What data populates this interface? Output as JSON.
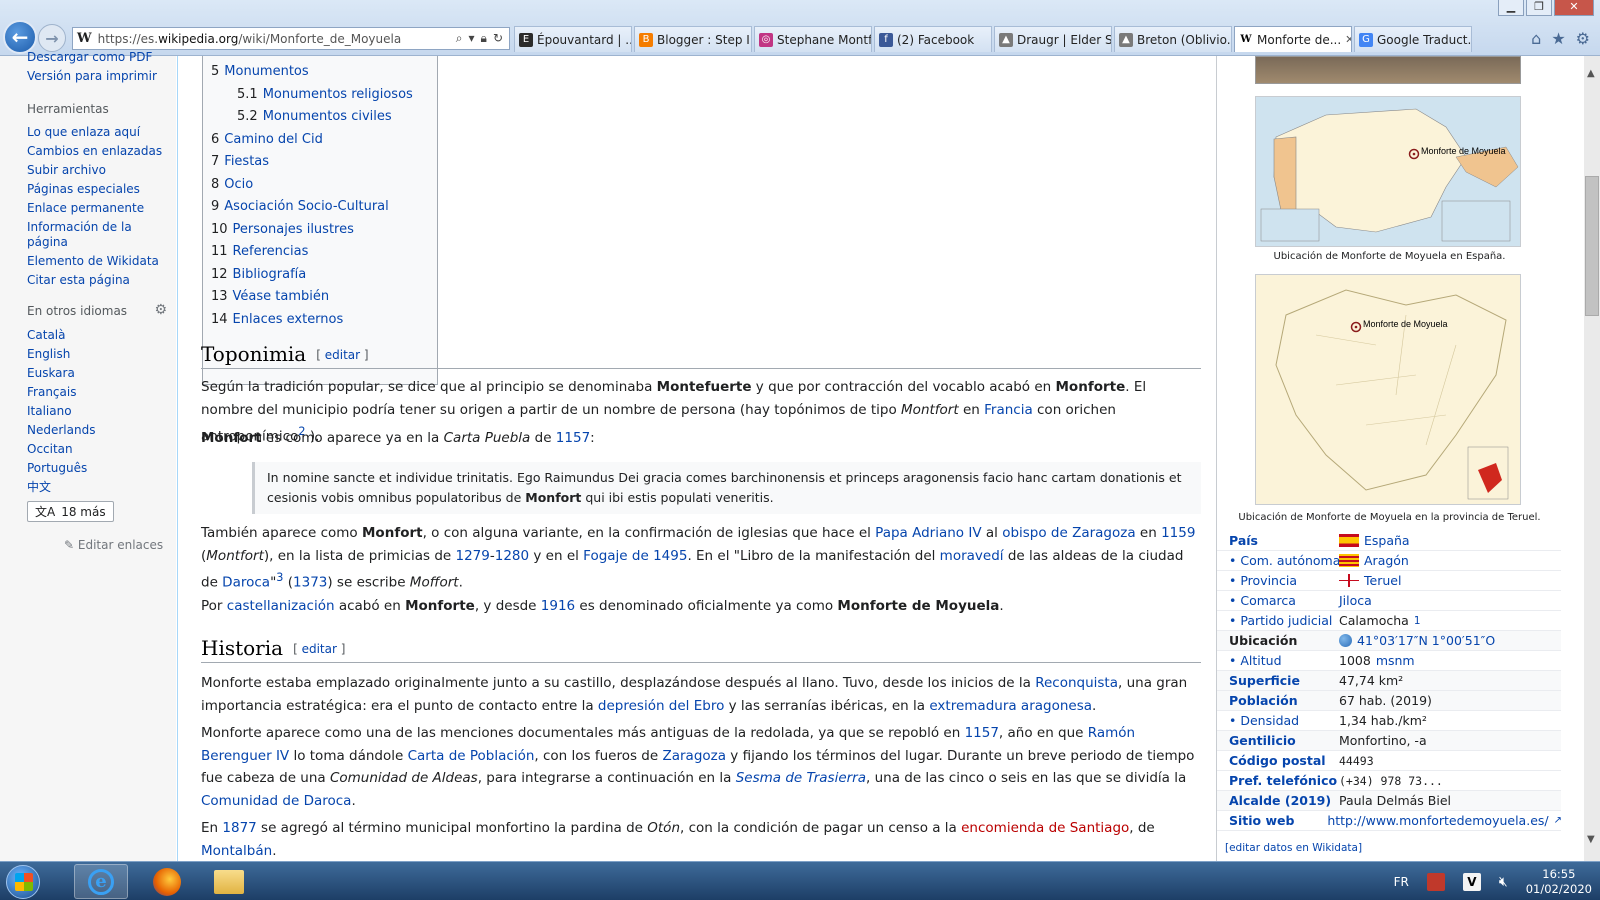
{
  "browser": {
    "url_prefix": "https://es.",
    "url_domain": "wikipedia.org",
    "url_path": "/wiki/Monforte_de_Moyuela",
    "tabs": [
      {
        "label": "Épouvantard | ...",
        "color": "#2b2b2b",
        "glyph": "E",
        "active": false
      },
      {
        "label": "Blogger : Step I...",
        "color": "#f57d00",
        "glyph": "B",
        "active": false
      },
      {
        "label": "Stephane Montf...",
        "color": "#c13584",
        "glyph": "◎",
        "active": false
      },
      {
        "label": "(2) Facebook",
        "color": "#3b5998",
        "glyph": "f",
        "active": false
      },
      {
        "label": "Draugr | Elder S...",
        "color": "#7a7a7a",
        "glyph": "▲",
        "active": false
      },
      {
        "label": "Breton (Oblivio...",
        "color": "#7a7a7a",
        "glyph": "▲",
        "active": false
      },
      {
        "label": "Monforte de...",
        "color": "#ffffff",
        "glyph": "W",
        "active": true
      },
      {
        "label": "Google Traduct...",
        "color": "#4285f4",
        "glyph": "G",
        "active": false
      }
    ]
  },
  "sidebar": {
    "top_links": [
      "Descargar como PDF",
      "Versión para imprimir"
    ],
    "tools_heading": "Herramientas",
    "tools": [
      "Lo que enlaza aquí",
      "Cambios en enlazadas",
      "Subir archivo",
      "Páginas especiales",
      "Enlace permanente",
      "Información de la página",
      "Elemento de Wikidata",
      "Citar esta página"
    ],
    "langs_heading": "En otros idiomas",
    "languages": [
      "Català",
      "English",
      "Euskara",
      "Français",
      "Italiano",
      "Nederlands",
      "Occitan",
      "Português",
      "中文"
    ],
    "more_langs": "18 más",
    "edit_links": "Editar enlaces"
  },
  "toc": [
    {
      "num": "5",
      "label": "Monumentos",
      "sub": false
    },
    {
      "num": "5.1",
      "label": "Monumentos religiosos",
      "sub": true
    },
    {
      "num": "5.2",
      "label": "Monumentos civiles",
      "sub": true
    },
    {
      "num": "6",
      "label": "Camino del Cid",
      "sub": false
    },
    {
      "num": "7",
      "label": "Fiestas",
      "sub": false
    },
    {
      "num": "8",
      "label": "Ocio",
      "sub": false
    },
    {
      "num": "9",
      "label": "Asociación Socio-Cultural",
      "sub": false
    },
    {
      "num": "10",
      "label": "Personajes ilustres",
      "sub": false
    },
    {
      "num": "11",
      "label": "Referencias",
      "sub": false
    },
    {
      "num": "12",
      "label": "Bibliografía",
      "sub": false
    },
    {
      "num": "13",
      "label": "Véase también",
      "sub": false
    },
    {
      "num": "14",
      "label": "Enlaces externos",
      "sub": false
    }
  ],
  "article": {
    "edit_label": "editar",
    "toponimia": {
      "heading": "Toponimia",
      "p1_html": "Según la tradición popular, se dice que al principio se denominaba <b>Montefuerte</b> y que por contracción del vocablo acabó en <b>Monforte</b>. El nombre del municipio podría tener su origen a partir de un nombre de persona (hay topónimos de tipo <i>Montfort</i> en <a>Francia</a> con orichen antroponímico<sup><a>2</a></sup> ).",
      "p2_html": "<b>Monfort</b> es como aparece ya en la <i>Carta Puebla</i> de <a>1157</a>:",
      "quote_html": "In nomine sancte et individue trinitatis. Ego Raimundus Dei gracia comes barchinonensis et princeps aragonensis facio hanc cartam donationis et cesionis vobis omnibus populatoribus de <b>Monfort</b> qui ibi estis populati veneritis.",
      "p3_html": "También aparece como <b>Monfort</b>, o con alguna variante, en la confirmación de iglesias que hace el <a>Papa Adriano IV</a> al <a>obispo de Zaragoza</a> en <a>1159</a> (<i>Montfort</i>), en la lista de primicias de <a>1279</a>-<a>1280</a> y en el <a>Fogaje de 1495</a>. En el \"Libro de la manifestación del <a>moravedí</a> de las aldeas de la ciudad de <a>Daroca</a>\"<sup><a>3</a></sup> (<a>1373</a>) se escribe <i>Moffort</i>.",
      "p4_html": "Por <a>castellanización</a> acabó en <b>Monforte</b>, y desde <a>1916</a> es denominado oficialmente ya como <b>Monforte de Moyuela</b>."
    },
    "historia": {
      "heading": "Historia",
      "p1_html": "Monforte estaba emplazado originalmente junto a su castillo, desplazándose después al llano. Tuvo, desde los inicios de la <a>Reconquista</a>, una gran importancia estratégica: era el punto de contacto entre la <a>depresión del Ebro</a> y las serranías ibéricas, en la <a>extremadura aragonesa</a>.",
      "p2_html": "Monforte aparece como una de las menciones documentales más antiguas de la redolada, ya que se repobló en <a>1157</a>, año en que <a>Ramón Berenguer IV</a> lo toma dándole <a>Carta de Población</a>, con los fueros de <a>Zaragoza</a> y fijando los términos del lugar. Durante un breve periodo de tiempo fue cabeza de una <i>Comunidad de Aldeas</i>, para integrarse a continuación en la <i><a>Sesma de Trasierra</a></i>, una de las cinco o seis en las que se dividía la <a>Comunidad de Daroca</a>.",
      "p3_html": "En <a>1877</a> se agregó al término municipal monfortino la pardina de <i>Otón</i>, con la condición de pagar un censo a la <a class=\"red\">encomienda de Santiago</a>, de <a>Montalbán</a>."
    }
  },
  "infobox": {
    "map1_label": "Monforte de Moyuela",
    "map1_caption": "Ubicación de Monforte de Moyuela en España.",
    "map2_label": "Monforte de Moyuela",
    "map2_caption": "Ubicación de Monforte de Moyuela en la provincia de Teruel.",
    "rows": [
      {
        "label": "País",
        "value": "España",
        "kind": "flag-es",
        "link": true,
        "sub": false
      },
      {
        "label": "• Com. autónoma",
        "value": "Aragón",
        "kind": "flag-ar",
        "link": true,
        "sub": true
      },
      {
        "label": "• Provincia",
        "value": "Teruel",
        "kind": "flag-te",
        "link": true,
        "sub": true
      },
      {
        "label": "• Comarca",
        "value": "Jiloca",
        "kind": "",
        "link": true,
        "sub": true
      },
      {
        "label": "• Partido judicial",
        "value": "Calamocha",
        "sup": "1",
        "kind": "",
        "link": false,
        "sub": true
      },
      {
        "label": "Ubicación",
        "value": "41°03′17″N 1°00′51″O",
        "kind": "globe",
        "link": true,
        "sub": false,
        "black": true,
        "tint": true
      },
      {
        "label": "• Altitud",
        "value": "1008",
        "unit": "msnm",
        "kind": "",
        "link": false,
        "sub": true
      },
      {
        "label": "Superficie",
        "value": "47,74 km²",
        "kind": "",
        "link": false,
        "sub": false,
        "tint": true
      },
      {
        "label": "Población",
        "value": "67 hab. (2019)",
        "kind": "",
        "link": false,
        "sub": false,
        "tint": true
      },
      {
        "label": "• Densidad",
        "value": "1,34 hab./km²",
        "kind": "",
        "link": false,
        "sub": true
      },
      {
        "label": "Gentilicio",
        "value": "Monfortino, -a",
        "kind": "",
        "link": false,
        "sub": false,
        "tint": true
      },
      {
        "label": "Código postal",
        "value": "44493",
        "kind": "mono",
        "link": false,
        "sub": false
      },
      {
        "label": "Pref. telefónico",
        "value": "(+34) 978 73...",
        "kind": "mono",
        "link": false,
        "sub": false
      },
      {
        "label": "Alcalde (2019)",
        "value": "Paula Delmás Biel",
        "kind": "",
        "link": false,
        "sub": false,
        "tint": true
      },
      {
        "label": "Sitio web",
        "value": "http://www.monfortedemoyuela.es/",
        "kind": "ext",
        "link": true,
        "sub": false
      }
    ],
    "edit_wikidata": "[editar datos en Wikidata]"
  },
  "taskbar": {
    "lang": "FR",
    "time": "16:55",
    "date": "01/02/2020"
  }
}
